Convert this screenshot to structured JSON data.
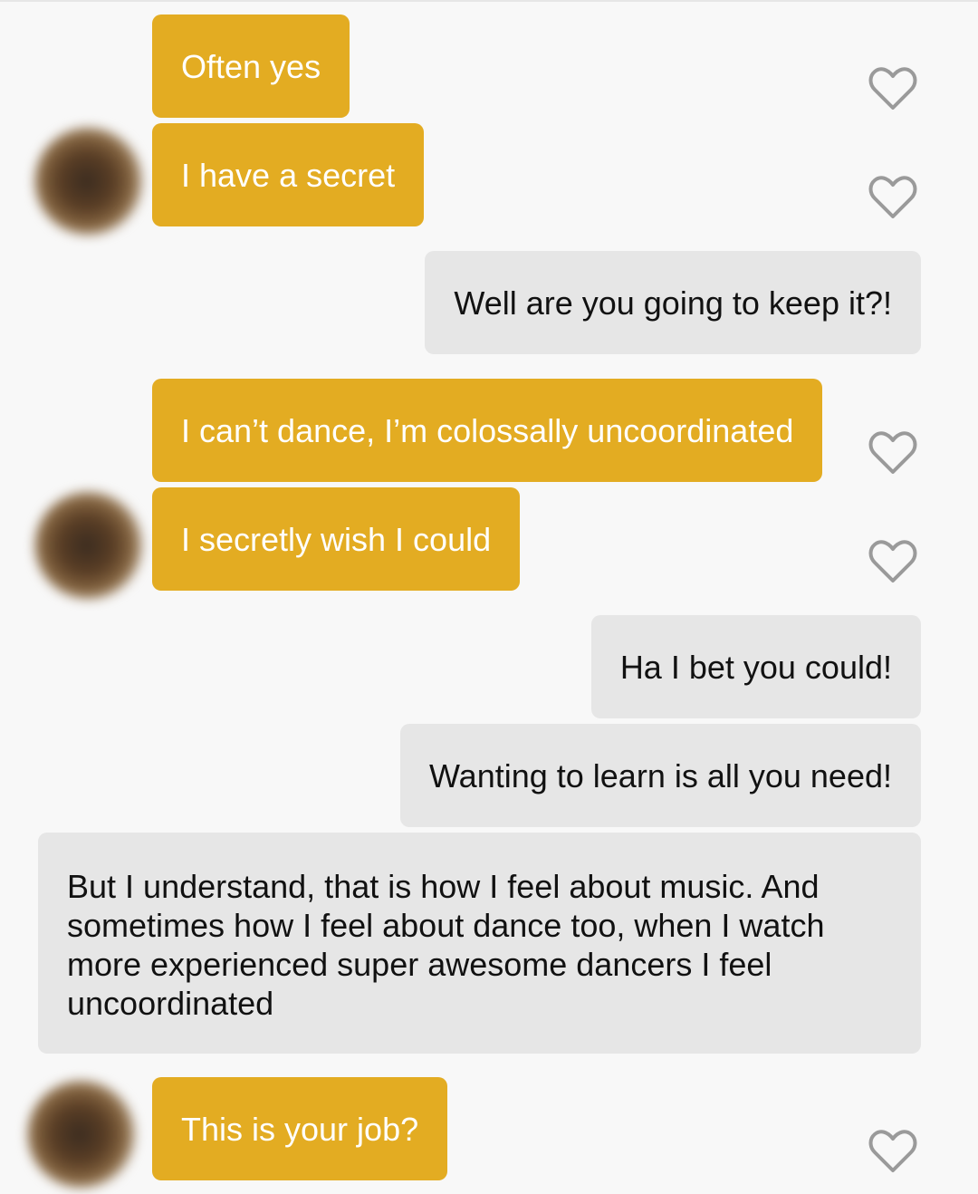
{
  "conversation": {
    "messages": [
      {
        "sender": "them",
        "text": "Often yes",
        "liked": false
      },
      {
        "sender": "them",
        "text": "I have a secret",
        "liked": false
      },
      {
        "sender": "me",
        "text": "Well are you going to keep it?!"
      },
      {
        "sender": "them",
        "text": "I can’t dance, I’m colossally uncoordinated",
        "liked": false
      },
      {
        "sender": "them",
        "text": "I secretly wish I could",
        "liked": false
      },
      {
        "sender": "me",
        "text": "Ha I bet you could!"
      },
      {
        "sender": "me",
        "text": "Wanting to learn is all you need!"
      },
      {
        "sender": "me",
        "text": "But I understand, that is how I feel about music. And sometimes how I feel about dance too, when I watch more experienced super awesome dancers I feel uncoordinated"
      },
      {
        "sender": "them",
        "text": "This is your job?",
        "liked": false
      }
    ]
  },
  "icons": {
    "like": "heart-outline-icon"
  },
  "colors": {
    "incoming_bubble": "#e3ac22",
    "outgoing_bubble": "#e6e6e6",
    "heart_outline": "#9a9a9a",
    "background": "#f8f8f8"
  }
}
